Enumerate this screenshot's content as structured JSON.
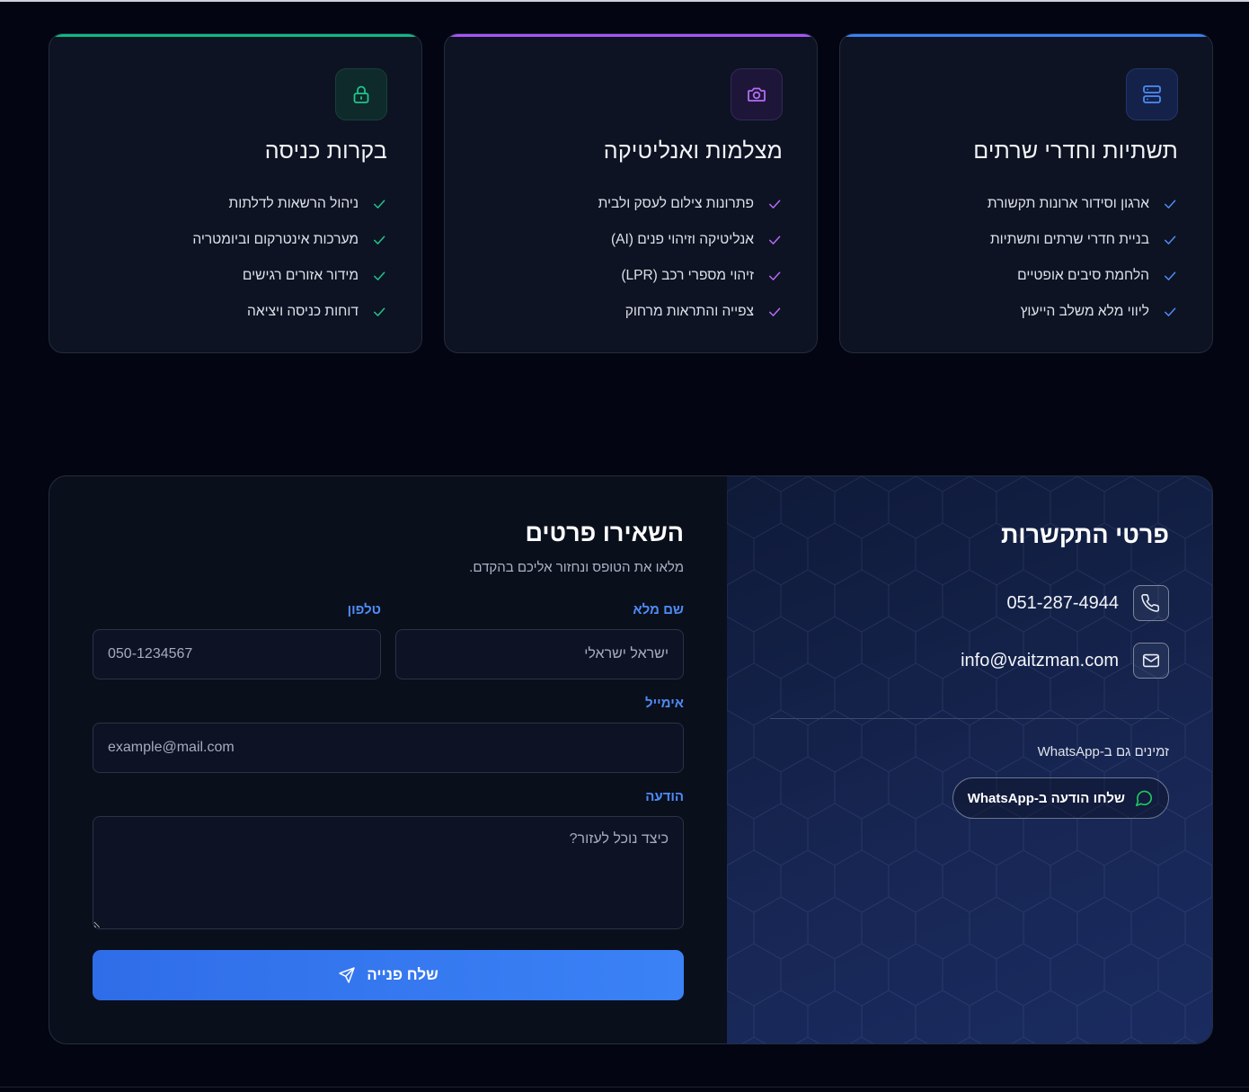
{
  "services": [
    {
      "title": "תשתיות וחדרי שרתים",
      "icon": "server-icon",
      "accent": "#3b82f6",
      "items": [
        "ארגון וסידור ארונות תקשורת",
        "בניית חדרי שרתים ותשתיות",
        "הלחמת סיבים אופטיים",
        "ליווי מלא משלב הייעוץ"
      ]
    },
    {
      "title": "מצלמות ואנליטיקה",
      "icon": "camera-icon",
      "accent": "#a855f7",
      "items": [
        "פתרונות צילום לעסק ולבית",
        "אנליטיקה וזיהוי פנים (AI)",
        "זיהוי מספרי רכב (LPR)",
        "צפייה והתראות מרחוק"
      ]
    },
    {
      "title": "בקרות כניסה",
      "icon": "lock-icon",
      "accent": "#10b981",
      "items": [
        "ניהול הרשאות לדלתות",
        "מערכות אינטרקום וביומטריה",
        "מידור אזורים רגישים",
        "דוחות כניסה ויציאה"
      ]
    }
  ],
  "contact_info": {
    "title": "פרטי התקשרות",
    "phone": "051-287-4944",
    "email": "info@vaitzman.com",
    "whatsapp_label": "זמינים גם ב-WhatsApp",
    "whatsapp_button": "שלחו הודעה ב-WhatsApp"
  },
  "form": {
    "title": "השאירו פרטים",
    "subtitle": "מלאו את הטופס ונחזור אליכם בהקדם.",
    "name_label": "שם מלא",
    "name_placeholder": "ישראל ישראלי",
    "phone_label": "טלפון",
    "phone_placeholder": "050-1234567",
    "email_label": "אימייל",
    "email_placeholder": "example@mail.com",
    "message_label": "הודעה",
    "message_placeholder": "כיצד נוכל לעזור?",
    "submit_label": "שלח פנייה"
  }
}
